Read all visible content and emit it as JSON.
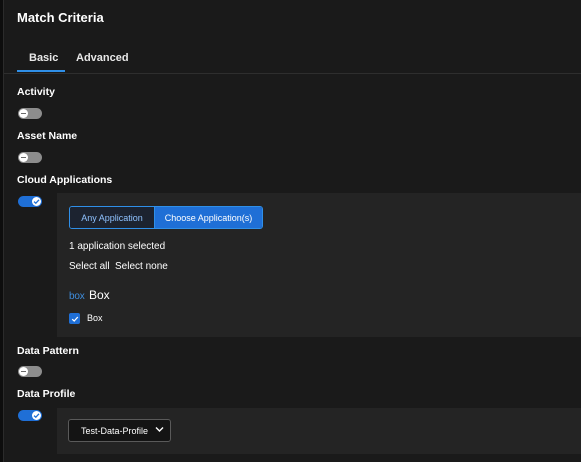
{
  "title": "Match Criteria",
  "tabs": [
    {
      "label": "Basic",
      "active": true
    },
    {
      "label": "Advanced",
      "active": false
    }
  ],
  "fields": {
    "activity": {
      "label": "Activity",
      "enabled": false
    },
    "asset_name": {
      "label": "Asset Name",
      "enabled": false
    },
    "cloud_applications": {
      "label": "Cloud Applications",
      "enabled": true,
      "segments": {
        "any": "Any Application",
        "choose": "Choose Application(s)",
        "selected": "choose"
      },
      "selection_count_text": "1 application selected",
      "select_all": "Select all",
      "select_none": "Select none",
      "app_group": {
        "logo_text": "box",
        "name": "Box"
      },
      "apps": [
        {
          "label": "Box",
          "checked": true
        }
      ]
    },
    "data_pattern": {
      "label": "Data Pattern",
      "enabled": false
    },
    "data_profile": {
      "label": "Data Profile",
      "enabled": true,
      "selected_value": "Test-Data-Profile"
    }
  },
  "colors": {
    "accent": "#1f6fd6",
    "link": "#8fc2ff",
    "box_brand": "#3f8ede"
  }
}
